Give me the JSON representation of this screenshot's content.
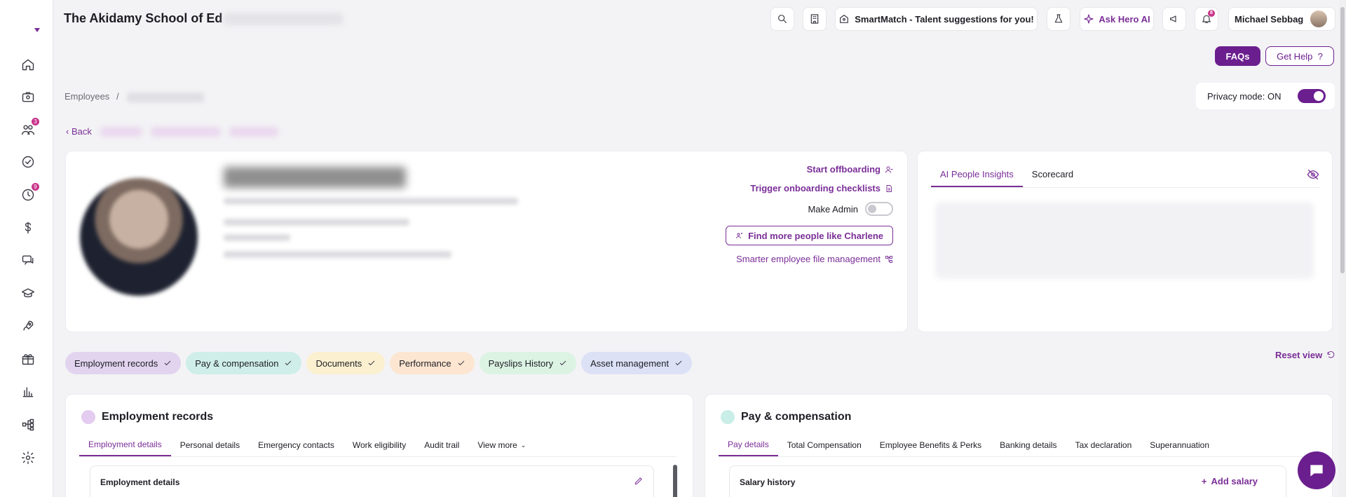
{
  "header": {
    "company": "The Akidamy School of Ed",
    "smartmatch_label": "SmartMatch - Talent suggestions for you!",
    "ask_hero_label": "Ask Hero AI",
    "notification_count": "8",
    "user_name": "Michael Sebbag",
    "faqs_label": "FAQs",
    "get_help_label": "Get Help"
  },
  "sidebar": {
    "badges": {
      "people": "3",
      "time": "9"
    }
  },
  "breadcrumb": {
    "root": "Employees",
    "separator": "/"
  },
  "back": {
    "label": "Back"
  },
  "privacy": {
    "label": "Privacy mode: ON",
    "enabled": true
  },
  "profile": {
    "actions": {
      "start_offboarding": "Start offboarding",
      "trigger_onboarding": "Trigger onboarding checklists",
      "make_admin": "Make Admin",
      "find_more": "Find more people like Charlene",
      "file_management": "Smarter employee file management"
    }
  },
  "insights": {
    "tabs": [
      "AI People Insights",
      "Scorecard"
    ],
    "active_tab": 0
  },
  "section_tabs": [
    {
      "label": "Employment records",
      "color": "#e2d3ef"
    },
    {
      "label": "Pay & compensation",
      "color": "#cfeee9"
    },
    {
      "label": "Documents",
      "color": "#fbf0cf"
    },
    {
      "label": "Performance",
      "color": "#fde6d1"
    },
    {
      "label": "Payslips History",
      "color": "#dcf3e4"
    },
    {
      "label": "Asset management",
      "color": "#dce1f6"
    }
  ],
  "reset_view_label": "Reset view",
  "employment_panel": {
    "title": "Employment records",
    "dot_color": "#e3ccef",
    "tabs": [
      "Employment details",
      "Personal details",
      "Emergency contacts",
      "Work eligibility",
      "Audit trail",
      "View more"
    ],
    "sub_title": "Employment details"
  },
  "pay_panel": {
    "title": "Pay & compensation",
    "dot_color": "#c9eee8",
    "tabs": [
      "Pay details",
      "Total Compensation",
      "Employee Benefits & Perks",
      "Banking details",
      "Tax declaration",
      "Superannuation"
    ],
    "sub_title": "Salary history",
    "add_label": "Add salary"
  },
  "colors": {
    "accent": "#7a2e97",
    "accent_dark": "#6b1f8f",
    "badge": "#c9338a"
  }
}
